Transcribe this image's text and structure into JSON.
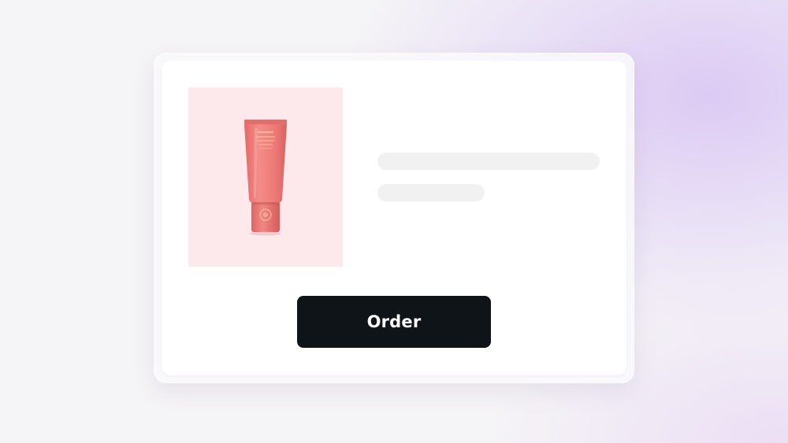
{
  "product": {
    "image_icon": "cosmetic-tube-icon",
    "image_background": "#fde9ec",
    "tube_color": "#f07d7a"
  },
  "actions": {
    "order_label": "Order"
  },
  "colors": {
    "button_background": "#0e1418",
    "button_text": "#ffffff",
    "skeleton": "#f1f1f1",
    "card_background": "#ffffff"
  }
}
